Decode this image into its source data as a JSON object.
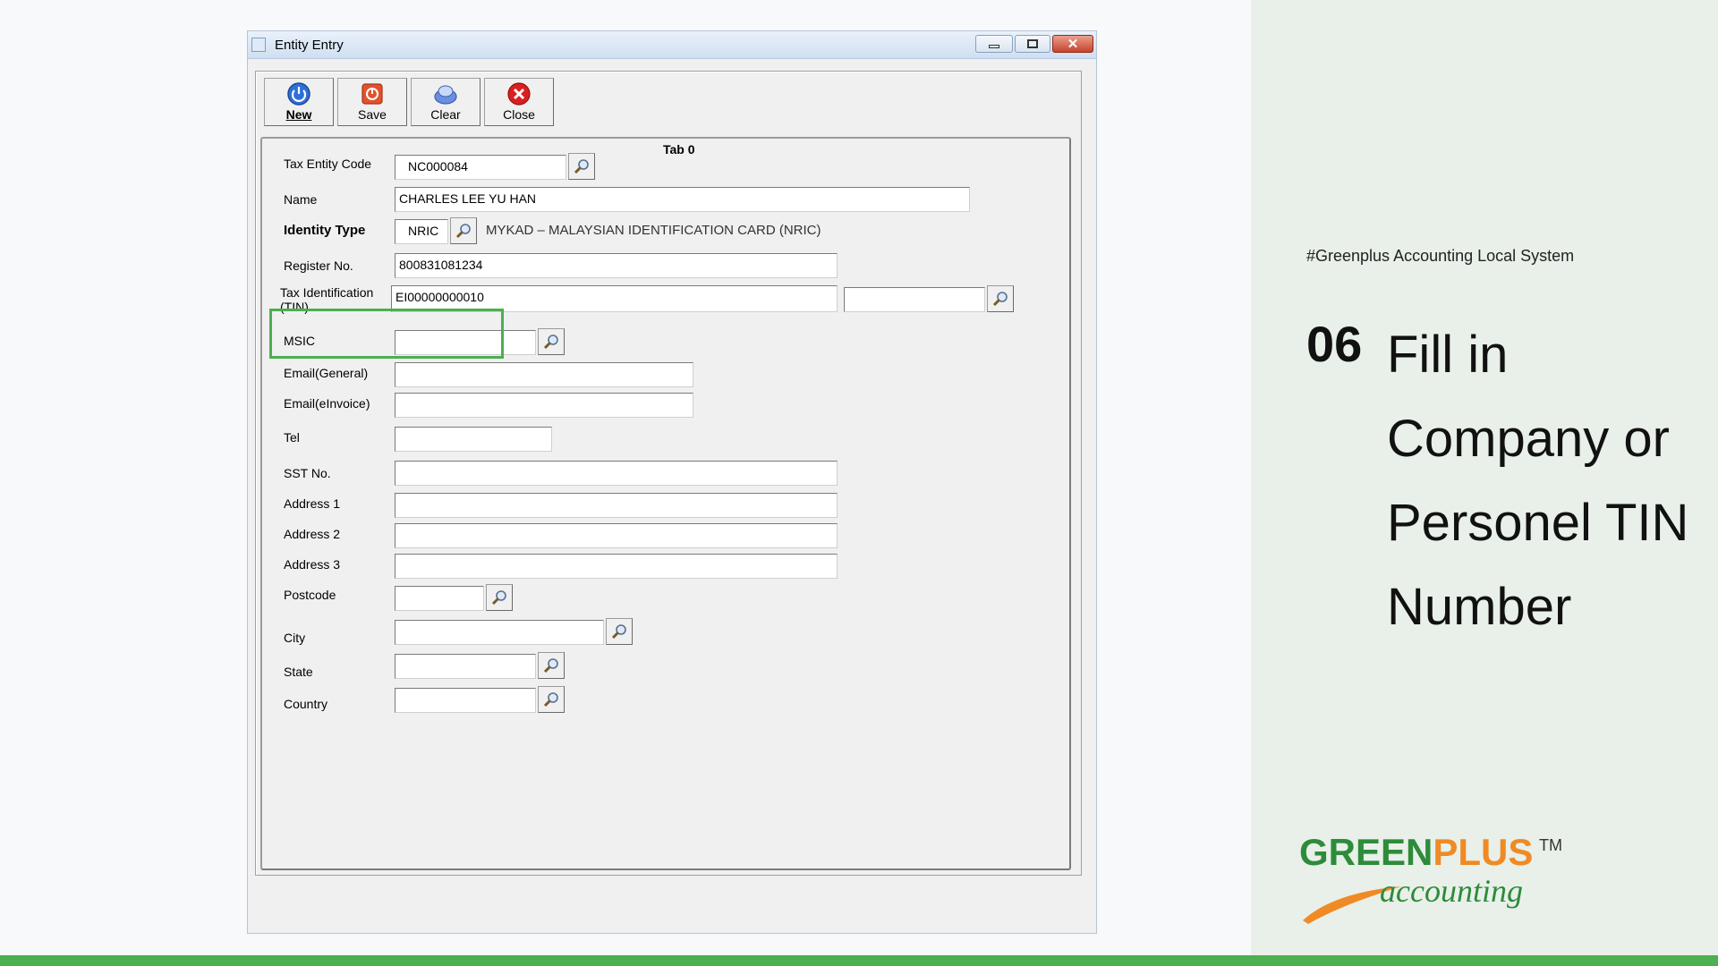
{
  "window": {
    "title": "Entity Entry"
  },
  "toolbar": {
    "new_label": "New",
    "save_label": "Save",
    "clear_label": "Clear",
    "close_label": "Close"
  },
  "form": {
    "tab_title": "Tab 0",
    "tax_entity_code_label": "Tax Entity Code",
    "tax_entity_code_value": "NC000084",
    "name_label": "Name",
    "name_value": "CHARLES LEE YU HAN",
    "identity_type_label": "Identity Type",
    "identity_type_value": "NRIC",
    "identity_type_desc": "MYKAD – MALAYSIAN IDENTIFICATION CARD (NRIC)",
    "register_no_label": "Register No.",
    "register_no_value": "800831081234",
    "tin_label_line1": "Tax Identification",
    "tin_label_line2": "(TIN)",
    "tin_value": "EI00000000010",
    "tin_extra_value": "",
    "msic_label": "MSIC",
    "email_general_label": "Email(General)",
    "email_einvoice_label": "Email(eInvoice)",
    "tel_label": "Tel",
    "sst_label": "SST No.",
    "address1_label": "Address 1",
    "address2_label": "Address 2",
    "address3_label": "Address 3",
    "postcode_label": "Postcode",
    "city_label": "City",
    "state_label": "State",
    "country_label": "Country"
  },
  "side": {
    "hashtag": "#Greenplus Accounting Local System",
    "step_number": "06",
    "step_title": "Fill in Company or Personel TIN Number",
    "logo_green": "GREEN",
    "logo_plus": "PLUS",
    "logo_tm": "TM",
    "logo_accounting": "accounting"
  },
  "colors": {
    "highlight": "#4caf50",
    "brand_green": "#2e8b3a",
    "brand_orange": "#f08a24",
    "side_bg": "#e8f0e9"
  }
}
